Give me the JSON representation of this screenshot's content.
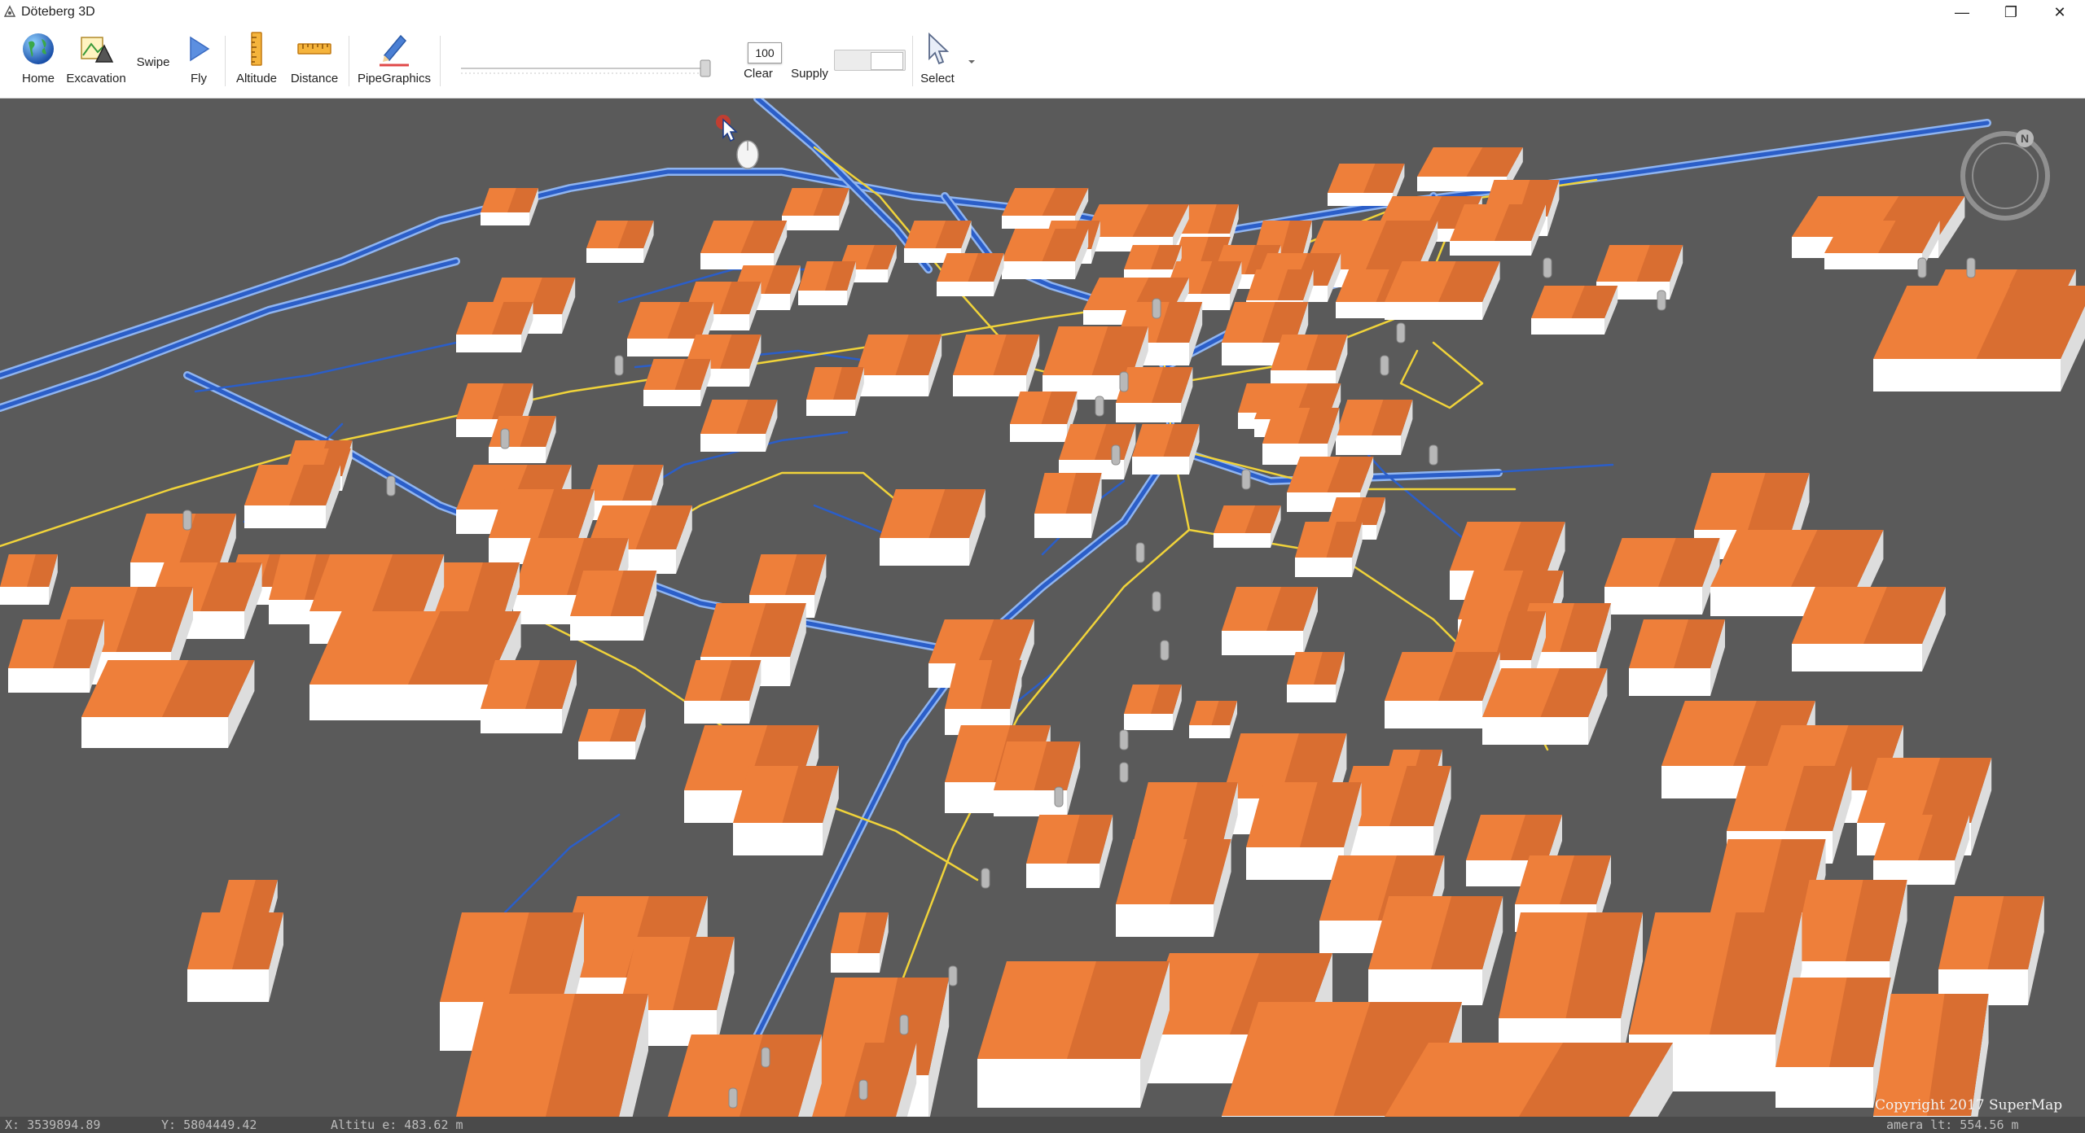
{
  "window": {
    "title": "Döteberg 3D",
    "controls": {
      "minimize": "—",
      "restore": "❐",
      "close": "✕"
    }
  },
  "toolbar": {
    "items": [
      {
        "label": "Home",
        "icon": "globe-icon"
      },
      {
        "label": "Excavation",
        "icon": "excavation-icon"
      },
      {
        "label": "Swipe",
        "icon": "swipe-icon"
      },
      {
        "label": "Fly",
        "icon": "fly-play-icon"
      },
      {
        "label": "Altitude",
        "icon": "altitude-ruler-icon"
      },
      {
        "label": "Distance",
        "icon": "distance-ruler-icon"
      },
      {
        "label": "PipeGraphics",
        "icon": "pencil-icon"
      },
      {
        "label": "Clear",
        "icon": ""
      },
      {
        "label": "Supply",
        "icon": ""
      },
      {
        "label": "Select",
        "icon": "cursor-arrow-icon"
      }
    ],
    "opacity_slider": {
      "value": "100",
      "fraction": 1.0
    }
  },
  "status": {
    "x": "X: 3539894.89",
    "y": "Y: 5804449.42",
    "altitude": "Altitu   e: 483.62 m",
    "camera": "amera   lt: 554.56 m"
  },
  "copyright": "Copyright 2017 SuperMap",
  "compass": {
    "label": "N"
  },
  "colors": {
    "roof": "#ee7f3a",
    "roof_shade": "#c9612a",
    "wall": "#ffffff",
    "wall_shade": "#dddddd",
    "ground": "#5a5a5a",
    "pipe_blue": "#2b5ec8",
    "pipe_yellow": "#f0d33a"
  }
}
